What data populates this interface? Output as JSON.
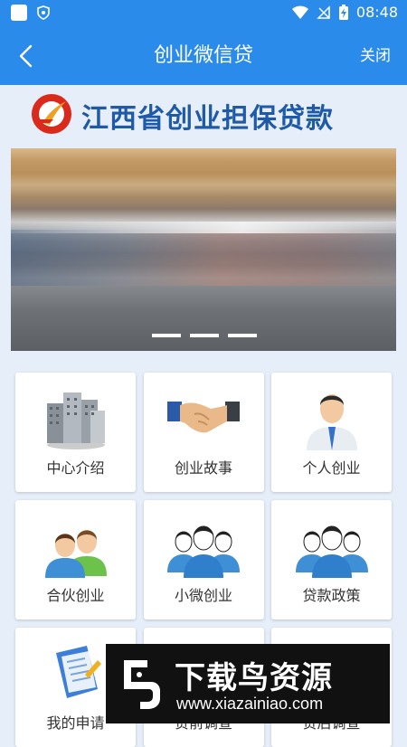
{
  "status_bar": {
    "time": "08:48"
  },
  "header": {
    "title": "创业微信贷",
    "close_label": "关闭"
  },
  "brand": {
    "text": "江西省创业担保贷款"
  },
  "carousel": {
    "slide_count": 3
  },
  "menu": [
    {
      "label": "中心介绍",
      "icon": "buildings-icon"
    },
    {
      "label": "创业故事",
      "icon": "handshake-icon"
    },
    {
      "label": "个人创业",
      "icon": "businessman-icon"
    },
    {
      "label": "合伙创业",
      "icon": "partners-icon"
    },
    {
      "label": "小微创业",
      "icon": "team-icon"
    },
    {
      "label": "贷款政策",
      "icon": "team-icon"
    },
    {
      "label": "我的申请",
      "icon": "document-icon"
    },
    {
      "label": "贷前调查",
      "icon": "survey-icon"
    },
    {
      "label": "贷后调查",
      "icon": "survey-icon"
    }
  ],
  "watermark": {
    "title": "下载鸟资源",
    "url": "www.xiazainiao.com"
  },
  "colors": {
    "primary": "#2b8bea",
    "brand_text": "#1f5aa8",
    "background": "#e6eef9"
  }
}
